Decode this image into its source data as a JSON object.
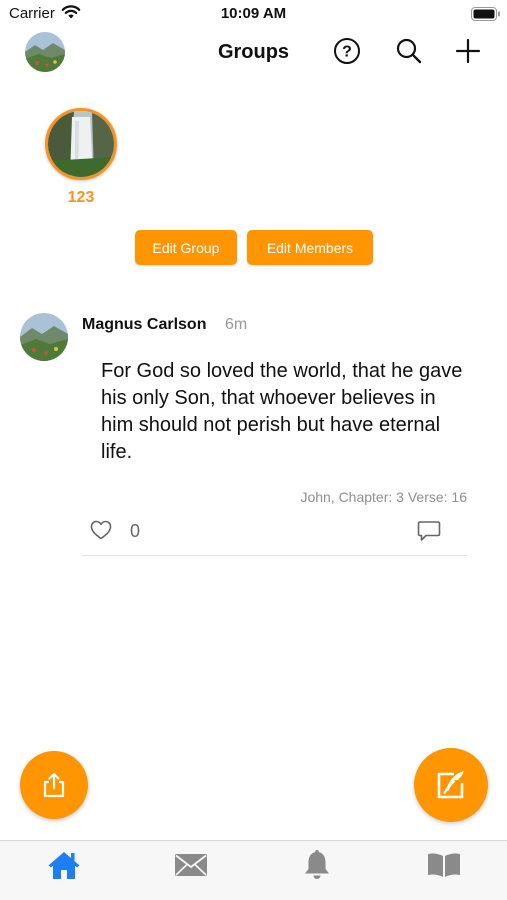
{
  "status_bar": {
    "carrier": "Carrier",
    "time": "10:09 AM"
  },
  "navbar": {
    "title": "Groups",
    "icons": [
      "help-icon",
      "search-icon",
      "plus-icon"
    ]
  },
  "group": {
    "name": "123",
    "edit_group_label": "Edit Group",
    "edit_members_label": "Edit Members"
  },
  "post": {
    "author": "Magnus Carlson",
    "time": "6m",
    "body": "For God so loved the world, that he gave his only Son, that whoever believes in him should not perish but have eternal life.",
    "reference": "John, Chapter: 3 Verse: 16",
    "like_count": "0"
  },
  "tabbar": {
    "tabs": [
      "home-icon",
      "mail-icon",
      "bell-icon",
      "book-icon"
    ],
    "active": "home-icon"
  },
  "colors": {
    "accent": "#ff9500",
    "active_tab": "#1e7ff5",
    "inactive_tab": "#8a8a8a"
  }
}
